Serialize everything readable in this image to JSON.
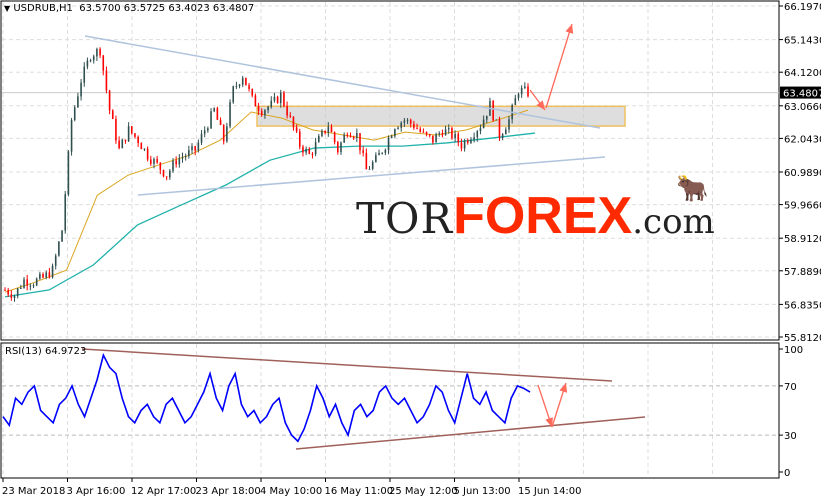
{
  "header": {
    "symbol_timeframe": "USDRUB,H1",
    "ohlc": "63.5700 63.5725 63.4023 63.4807",
    "menu_icon": "triangle-down-icon"
  },
  "watermark": {
    "text_left": "TOR",
    "text_mid": "FOREX",
    "text_right": ".com",
    "logo": "bull-icon"
  },
  "colors": {
    "bull_candle": "#2f4f4f",
    "bear_candle": "#ff0000",
    "ma_fast": "#daa520",
    "ma_slow": "#20b2aa",
    "trendline": "#b0c4de",
    "rsi_line": "#0000ff",
    "rsi_trendline": "#a0605a",
    "arrow": "#ff6a5a",
    "zone": "#f0c060"
  },
  "chart_data": [
    {
      "type": "candlestick",
      "title": "USDRUB,H1",
      "ylim": [
        55.812,
        66.197
      ],
      "y_ticks": [
        "66.1970",
        "65.1430",
        "64.1200",
        "63.0660",
        "62.0430",
        "60.9890",
        "59.9660",
        "58.9120",
        "57.8890",
        "56.8350",
        "55.8120"
      ],
      "current_price": "63.4807",
      "x_tick_labels": [
        "23 Mar 2018",
        "3 Apr 16:00",
        "12 Apr 17:00",
        "23 Apr 18:00",
        "4 May 10:00",
        "16 May 11:00",
        "25 May 12:00",
        "5 Jun 13:00",
        "15 Jun 14:00"
      ],
      "closes": [
        57.29,
        57.13,
        57.6,
        57.54,
        57.66,
        57.91,
        59.17,
        62.62,
        63.87,
        64.66,
        64.82,
        62.93,
        61.68,
        62.31,
        61.99,
        61.52,
        61.21,
        60.89,
        61.36,
        61.52,
        61.68,
        62.31,
        62.93,
        61.99,
        63.56,
        64.03,
        63.25,
        62.93,
        63.09,
        63.4,
        62.62,
        61.84,
        61.52,
        61.99,
        62.46,
        61.68,
        62.31,
        62.15,
        61.05,
        61.36,
        61.84,
        62.46,
        62.62,
        62.46,
        62.15,
        61.99,
        62.31,
        62.15,
        61.84,
        62.15,
        62.46,
        63.09,
        62.15,
        62.62,
        63.56,
        63.48
      ],
      "ma_fast": [
        57.22,
        57.54,
        57.91,
        60.26,
        60.89,
        61.21,
        61.52,
        61.99,
        62.87,
        62.68,
        62.31,
        62.15,
        61.99,
        62.24,
        62.15,
        62.31,
        62.62,
        62.93
      ],
      "ma_slow": [
        57.07,
        57.29,
        58.07,
        59.33,
        59.96,
        60.58,
        61.36,
        61.74,
        61.8,
        61.8,
        61.9,
        62.05,
        62.21
      ],
      "resistance_zone": [
        62.43,
        63.05
      ]
    },
    {
      "type": "line",
      "title": "RSI(13) 64.9723",
      "ylim": [
        0,
        100
      ],
      "y_ticks": [
        "100",
        "70",
        "30",
        "0"
      ],
      "levels": [
        70,
        30
      ],
      "values": [
        45,
        38,
        60,
        55,
        65,
        70,
        50,
        45,
        40,
        55,
        60,
        70,
        55,
        45,
        60,
        75,
        95,
        85,
        80,
        60,
        45,
        40,
        50,
        55,
        45,
        40,
        55,
        60,
        50,
        40,
        45,
        55,
        65,
        80,
        60,
        50,
        70,
        80,
        55,
        45,
        50,
        40,
        45,
        55,
        60,
        40,
        30,
        25,
        35,
        50,
        70,
        60,
        45,
        55,
        40,
        30,
        50,
        55,
        45,
        50,
        65,
        70,
        60,
        55,
        60,
        50,
        40,
        45,
        55,
        70,
        65,
        50,
        40,
        60,
        80,
        60,
        55,
        65,
        50,
        45,
        40,
        60,
        70,
        68,
        65
      ]
    }
  ]
}
